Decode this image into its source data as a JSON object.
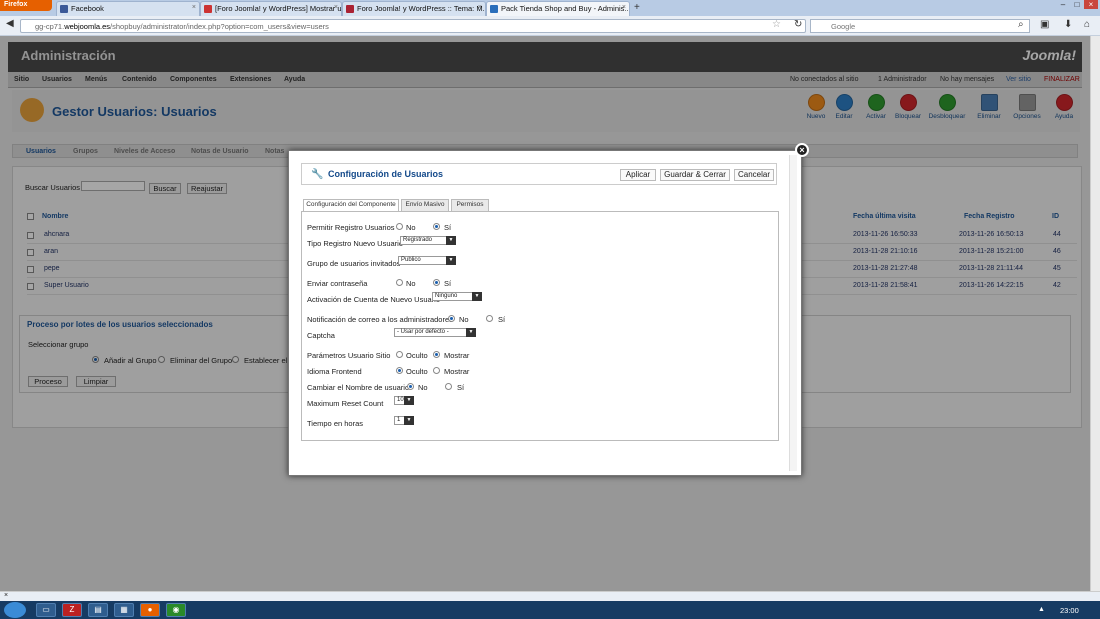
{
  "browser": {
    "menu_label": "Firefox",
    "tabs": [
      {
        "label": "Facebook",
        "active": false
      },
      {
        "label": "[Foro Joomla! y WordPress] Mostrar u...",
        "active": false
      },
      {
        "label": "Foro Joomla! y WordPress :: Tema: M...",
        "active": false
      },
      {
        "label": "Pack Tienda Shop and Buy - Adminis...",
        "active": true
      }
    ],
    "new_tab": "+",
    "url_prefix": "gg-cp71.",
    "url_domain": "webjoomla.es",
    "url_path": "/shopbuy/administrator/index.php?option=com_users&view=users",
    "search_engine": "Google",
    "status_close": "×"
  },
  "joomla": {
    "header_title": "Administración",
    "logo": "Joomla!",
    "menu": [
      "Sitio",
      "Usuarios",
      "Menús",
      "Contenido",
      "Componentes",
      "Extensiones",
      "Ayuda"
    ],
    "status": {
      "offline": "No conectados al sitio",
      "admins": "1 Administrador",
      "messages": "No hay mensajes",
      "view_site": "Ver sitio",
      "logout": "FINALIZAR"
    },
    "page_title": "Gestor Usuarios: Usuarios",
    "toolbar": [
      {
        "label": "Nuevo",
        "icon": "new-icon",
        "color": "#f08a1c"
      },
      {
        "label": "Editar",
        "icon": "edit-icon",
        "color": "#2d7fc6"
      },
      {
        "label": "Activar",
        "icon": "publish-icon",
        "color": "#2e9a2e"
      },
      {
        "label": "Bloquear",
        "icon": "block-icon",
        "color": "#d0262b"
      },
      {
        "label": "Desbloquear",
        "icon": "unblock-icon",
        "color": "#2e9a2e"
      },
      {
        "label": "Eliminar",
        "icon": "delete-icon",
        "color": "#4a7fb5"
      },
      {
        "label": "Opciones",
        "icon": "options-icon",
        "color": "#999999"
      },
      {
        "label": "Ayuda",
        "icon": "help-icon",
        "color": "#d0262b"
      }
    ],
    "submenu": [
      "Usuarios",
      "Grupos",
      "Niveles de Acceso",
      "Notas de Usuario",
      "Notas"
    ],
    "filter": {
      "search_label": "Buscar Usuarios",
      "search_value": "",
      "search_button": "Buscar",
      "reset_button": "Reajustar"
    },
    "table": {
      "col_name": "Nombre",
      "col_last_visit": "Fecha última visita",
      "col_registered": "Fecha Registro",
      "col_id": "ID",
      "rows": [
        {
          "name": "ahcnara",
          "last_visit": "2013-11-26 16:50:33",
          "registered": "2013-11-26 16:50:13",
          "id": "44"
        },
        {
          "name": "aran",
          "last_visit": "2013-11-28 21:10:16",
          "registered": "2013-11-28 15:21:00",
          "id": "46"
        },
        {
          "name": "pepe",
          "last_visit": "2013-11-28 21:27:48",
          "registered": "2013-11-28 21:11:44",
          "id": "45"
        },
        {
          "name": "Super Usuario",
          "last_visit": "2013-11-28 21:58:41",
          "registered": "2013-11-26 14:22:15",
          "id": "42"
        }
      ]
    },
    "batch": {
      "title": "Proceso por lotes de los usuarios seleccionados",
      "select_group": "Seleccionar grupo",
      "add": "Añadir al Grupo",
      "remove": "Eliminar del Grupo",
      "set": "Establecer el g",
      "process_button": "Proceso",
      "clear_button": "Limpiar"
    }
  },
  "modal": {
    "close": "×",
    "title": "Configuración de Usuarios",
    "apply": "Aplicar",
    "save_close": "Guardar & Cerrar",
    "cancel": "Cancelar",
    "tabs": [
      "Configuración del Componente",
      "Envío Masivo",
      "Permisos"
    ],
    "fields": {
      "allow_registration": {
        "label": "Permitir Registro Usuarios",
        "no": "No",
        "yes": "Sí",
        "value": "yes"
      },
      "new_user_type": {
        "label": "Tipo Registro Nuevo Usuario",
        "value": "Registrado"
      },
      "guest_group": {
        "label": "Grupo de usuarios invitados",
        "value": "Publico"
      },
      "send_password": {
        "label": "Enviar contraseña",
        "no": "No",
        "yes": "Sí",
        "value": "yes"
      },
      "activation": {
        "label": "Activación de Cuenta de Nuevo Usuario",
        "value": "Ninguno"
      },
      "admin_notify": {
        "label": "Notificación de correo a los administradores",
        "no": "No",
        "yes": "Sí",
        "value": "no"
      },
      "captcha": {
        "label": "Captcha",
        "value": "- Usar por defecto -"
      },
      "frontend_params": {
        "label": "Parámetros Usuario Sitio",
        "hide": "Oculto",
        "show": "Mostrar",
        "value": "show"
      },
      "frontend_lang": {
        "label": "Idioma Frontend",
        "hide": "Oculto",
        "show": "Mostrar",
        "value": "hide"
      },
      "change_username": {
        "label": "Cambiar el Nombre de usuario",
        "no": "No",
        "yes": "Sí",
        "value": "no"
      },
      "max_reset": {
        "label": "Maximum Reset Count",
        "value": "10"
      },
      "hours": {
        "label": "Tiempo en horas",
        "value": "1"
      }
    }
  },
  "taskbar": {
    "clock": "23:00"
  }
}
